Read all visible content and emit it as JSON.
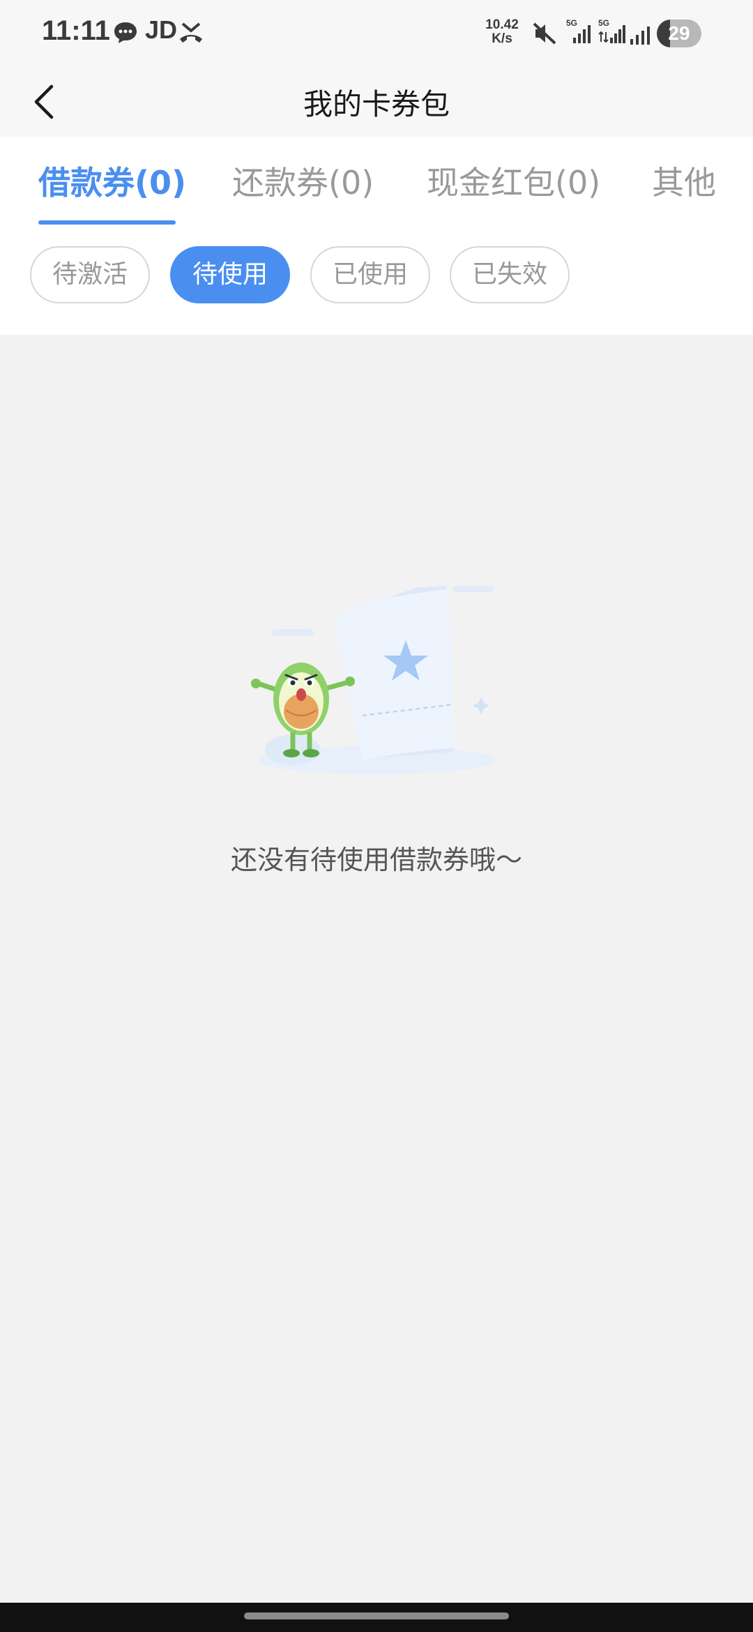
{
  "status_bar": {
    "time": "11:11",
    "app_label": "JD",
    "net_speed_value": "10.42",
    "net_speed_unit": "K/s",
    "signal_label_1": "5G",
    "signal_label_2": "5G",
    "battery_level": "29",
    "battery_fraction": 0.29
  },
  "header": {
    "title": "我的卡券包"
  },
  "tabs": [
    {
      "label": "借款券(0)",
      "active": true
    },
    {
      "label": "还款券(0)",
      "active": false
    },
    {
      "label": "现金红包(0)",
      "active": false
    },
    {
      "label": "其他",
      "active": false
    }
  ],
  "filters": [
    {
      "label": "待激活",
      "active": false
    },
    {
      "label": "待使用",
      "active": true
    },
    {
      "label": "已使用",
      "active": false
    },
    {
      "label": "已失效",
      "active": false
    }
  ],
  "empty_state": {
    "message": "还没有待使用借款券哦～"
  },
  "colors": {
    "accent": "#4a8ff0",
    "background": "#f2f2f2"
  },
  "icons": [
    "chat-bubble-icon",
    "missed-call-icon",
    "mute-icon",
    "signal-icon",
    "battery-icon",
    "back-arrow-icon"
  ]
}
